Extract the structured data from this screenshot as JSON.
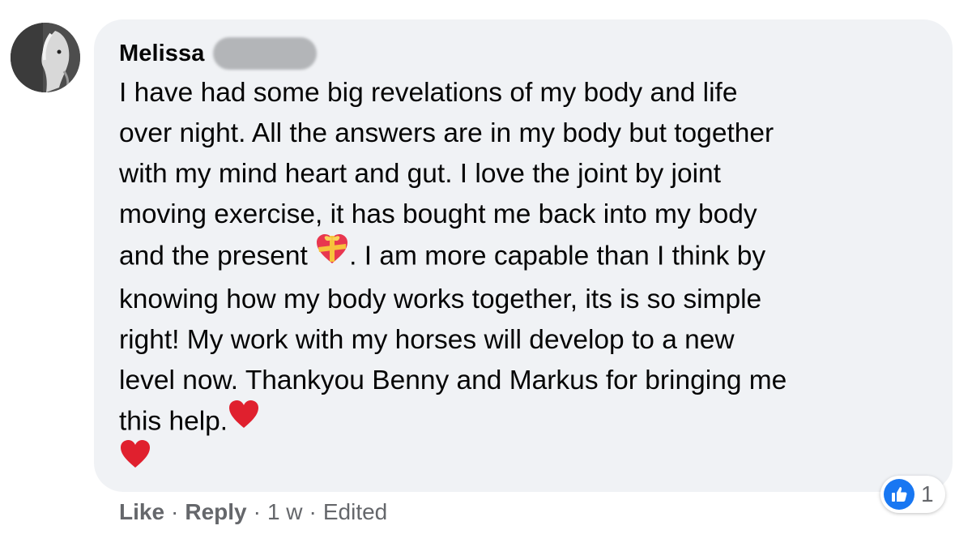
{
  "comment": {
    "author": "Melissa",
    "lines": [
      "I have had some big revelations of my body and life",
      "over night. All the answers are in my body but together",
      "with my mind heart and gut. I love the joint by joint",
      "moving exercise, it has bought me back into my body",
      "and the present",
      ". I am more capable than I think by",
      "knowing how my body works together, its is so simple",
      "right! My work with my horses will develop to a new",
      "level now. Thankyou Benny and Markus for bringing me",
      "this help."
    ],
    "emojis": [
      "gift-heart-icon",
      "red-heart-icon",
      "red-heart-icon"
    ]
  },
  "actions": {
    "like_label": "Like",
    "reply_label": "Reply",
    "separator": "·",
    "time": "1 w",
    "edited": "Edited"
  },
  "reaction": {
    "type": "like-icon",
    "count": "1"
  },
  "colors": {
    "bubble": "#f0f2f5",
    "text": "#050505",
    "secondary": "#65676b",
    "like_blue": "#1877f2",
    "heart_red": "#e0202e"
  }
}
